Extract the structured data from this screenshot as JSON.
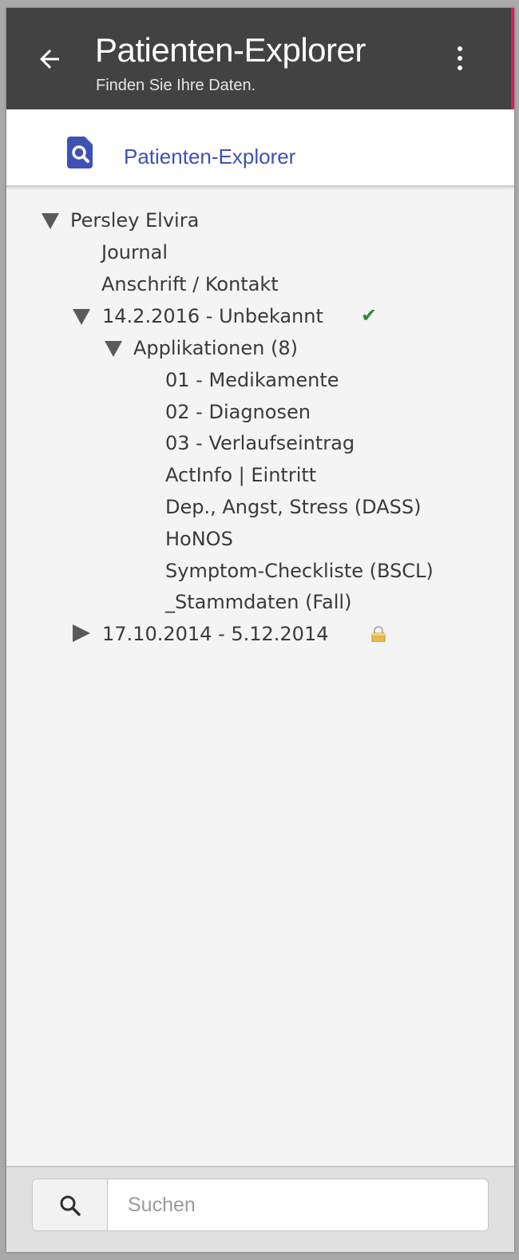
{
  "appbar": {
    "title": "Patienten-Explorer",
    "subtitle": "Finden Sie Ihre Daten.",
    "back_icon": "arrow-left-icon",
    "menu_icon": "more-vertical-icon"
  },
  "nav": {
    "label": "Patienten-Explorer",
    "icon": "document-search-icon",
    "accent_color": "#3f51b5"
  },
  "tree": {
    "patient": "Persley Elvira",
    "journal": "Journal",
    "address": "Anschrift / Kontakt",
    "case1": "14.2.2016 - Unbekannt",
    "case1_status": "✔",
    "applications": "Applikationen (8)",
    "apps": [
      "01 - Medikamente",
      "02 - Diagnosen",
      "03 - Verlaufseintrag",
      "ActInfo | Eintritt",
      "Dep., Angst, Stress (DASS)",
      "HoNOS",
      "Symptom-Checkliste (BSCL)",
      "_Stammdaten (Fall)"
    ],
    "case2": "17.10.2014 - 5.12.2014",
    "case2_status_icon": "lock-icon"
  },
  "search": {
    "placeholder": "Suchen",
    "value": "",
    "icon": "search-icon"
  },
  "colors": {
    "appbar": "#424242",
    "accent_strip": "#d81b60",
    "check": "#2e8b3a"
  }
}
